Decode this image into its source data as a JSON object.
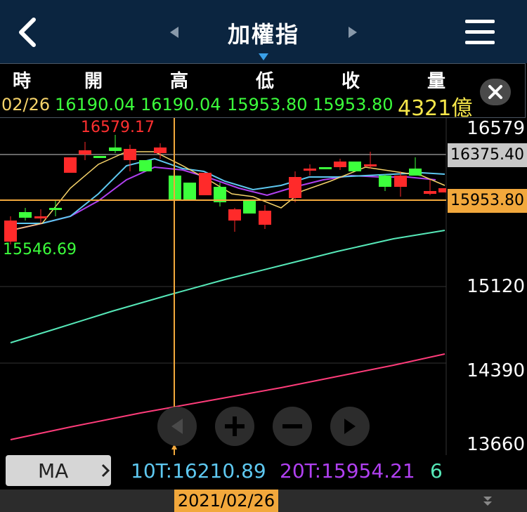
{
  "header": {
    "title": "加權指",
    "back_icon": "chevron-left-icon",
    "prev_icon": "caret-left-icon",
    "next_icon": "caret-right-icon",
    "menu_icon": "hamburger-menu-icon"
  },
  "quote": {
    "labels": [
      "時",
      "開",
      "高",
      "低",
      "收",
      "量"
    ],
    "time": "02/26",
    "open": "16190.04",
    "high": "16190.04",
    "low": "15953.80",
    "close": "15953.80",
    "volume": "4321億",
    "close_icon": "close-icon"
  },
  "chart": {
    "price_axis": [
      "16579",
      "15120",
      "14390",
      "13660"
    ],
    "crosshair_price": "16375.40",
    "last_price": "15953.80",
    "high_label": "16579.17",
    "low_label": "15546.69",
    "cursor_date": "2021/02/26",
    "colors": {
      "up": "#ff2a2a",
      "down": "#3cff3c",
      "ma5": "#f6d36a",
      "ma10": "#5ec8f0",
      "ma20": "#b040f0",
      "ma60": "#56e8b8",
      "ma120": "#ff3c7a",
      "cursor": "#f2a83c"
    }
  },
  "controls": {
    "ma_label": "MA",
    "ma10": "10T:16210.89",
    "ma20": "20T:15954.21",
    "ma60_partial": "6"
  }
}
